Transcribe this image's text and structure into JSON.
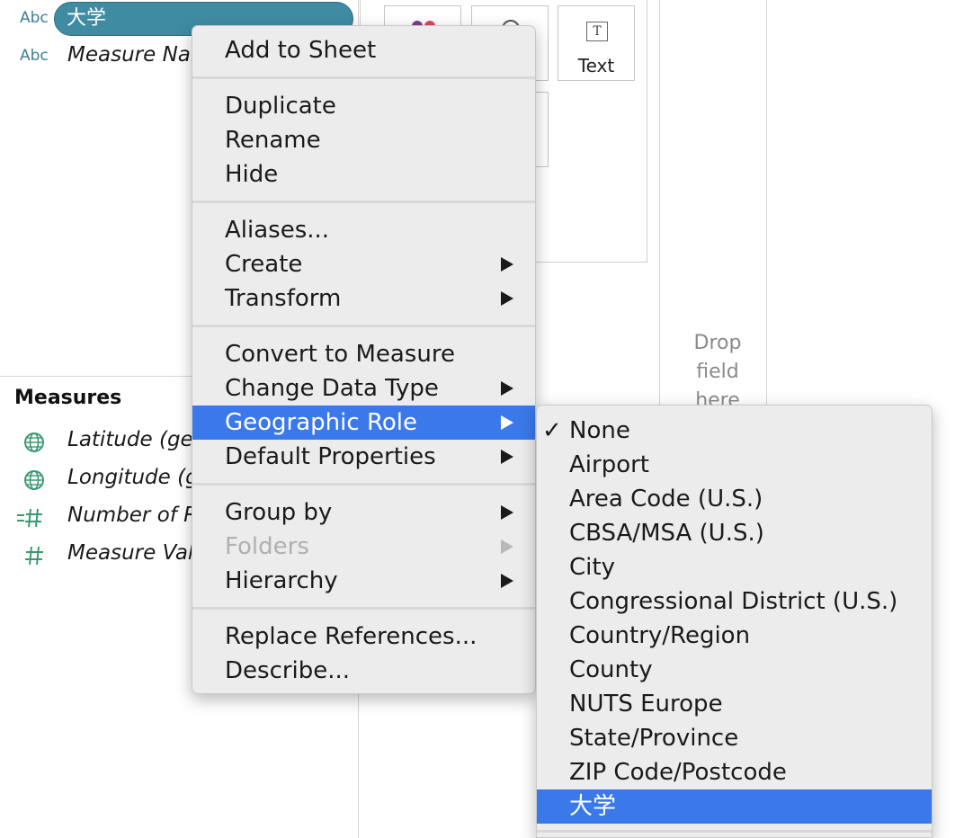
{
  "data_pane": {
    "dimensions": [
      {
        "type_label": "Abc",
        "name": "大学",
        "selected": true
      },
      {
        "type_label": "Abc",
        "name": "Measure Nar",
        "selected": false
      }
    ],
    "measures_title": "Measures",
    "measures": [
      {
        "icon": "globe-icon",
        "name": "Latitude (ger"
      },
      {
        "icon": "globe-icon",
        "name": "Longitude (g"
      },
      {
        "icon": "hash-calc-icon",
        "name": "Number of R"
      },
      {
        "icon": "hash-icon",
        "name": "Measure Valu"
      }
    ]
  },
  "marks_card": {
    "text_button_label": "Text",
    "text_icon_glyph": "T"
  },
  "view": {
    "drop_hint_lines": [
      "Drop",
      "field",
      "here"
    ]
  },
  "context_menu": {
    "items": [
      {
        "label": "Add to Sheet",
        "has_submenu": false,
        "disabled": false
      },
      {
        "label": "Duplicate",
        "has_submenu": false,
        "disabled": false
      },
      {
        "label": "Rename",
        "has_submenu": false,
        "disabled": false
      },
      {
        "label": "Hide",
        "has_submenu": false,
        "disabled": false
      },
      {
        "label": "Aliases...",
        "has_submenu": false,
        "disabled": false
      },
      {
        "label": "Create",
        "has_submenu": true,
        "disabled": false
      },
      {
        "label": "Transform",
        "has_submenu": true,
        "disabled": false
      },
      {
        "label": "Convert to Measure",
        "has_submenu": false,
        "disabled": false
      },
      {
        "label": "Change Data Type",
        "has_submenu": true,
        "disabled": false
      },
      {
        "label": "Geographic Role",
        "has_submenu": true,
        "disabled": false,
        "highlighted": true
      },
      {
        "label": "Default Properties",
        "has_submenu": true,
        "disabled": false
      },
      {
        "label": "Group by",
        "has_submenu": true,
        "disabled": false
      },
      {
        "label": "Folders",
        "has_submenu": true,
        "disabled": true
      },
      {
        "label": "Hierarchy",
        "has_submenu": true,
        "disabled": false
      },
      {
        "label": "Replace References...",
        "has_submenu": false,
        "disabled": false
      },
      {
        "label": "Describe...",
        "has_submenu": false,
        "disabled": false
      }
    ]
  },
  "geographic_role_menu": {
    "check_glyph": "✓",
    "items": [
      {
        "label": "None",
        "checked": true
      },
      {
        "label": "Airport"
      },
      {
        "label": "Area Code (U.S.)"
      },
      {
        "label": "CBSA/MSA (U.S.)"
      },
      {
        "label": "City"
      },
      {
        "label": "Congressional District (U.S.)"
      },
      {
        "label": "Country/Region"
      },
      {
        "label": "County"
      },
      {
        "label": "NUTS Europe"
      },
      {
        "label": "State/Province"
      },
      {
        "label": "ZIP Code/Postcode"
      },
      {
        "label": "大学",
        "highlighted": true
      }
    ]
  },
  "colors": {
    "accent": "#3b79ea",
    "pill": "#3f8ca2",
    "dimension_type": "#3d7e98",
    "measure_icon": "#3a9a72"
  }
}
